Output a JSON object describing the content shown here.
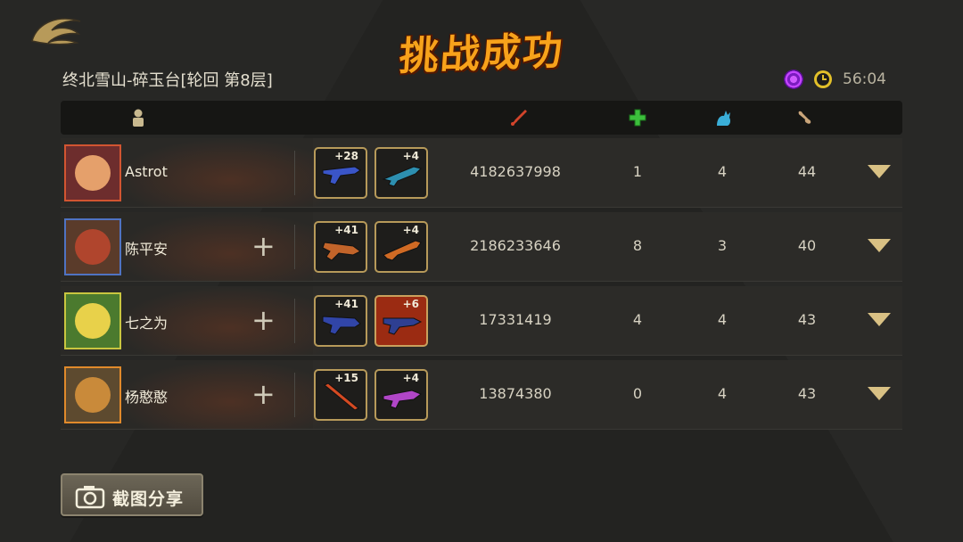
{
  "title": "挑战成功",
  "stage": "终北雪山-碎玉台[轮回 第8层]",
  "timer": "56:04",
  "headers": {
    "player_icon": "player-icon",
    "damage_icon": "sword-icon",
    "heal_icon": "green-cross-icon",
    "pet_icon": "blue-cat-icon",
    "bone_icon": "bone-icon"
  },
  "players": [
    {
      "name": "Astrot",
      "weapon1_level": "+28",
      "weapon2_level": "+4",
      "damage": "4182637998",
      "col1": "1",
      "col2": "4",
      "col3": "44",
      "has_plus": false
    },
    {
      "name": "陈平安",
      "weapon1_level": "+41",
      "weapon2_level": "+4",
      "damage": "2186233646",
      "col1": "8",
      "col2": "3",
      "col3": "40",
      "has_plus": true
    },
    {
      "name": "七之为",
      "weapon1_level": "+41",
      "weapon2_level": "+6",
      "damage": "17331419",
      "col1": "4",
      "col2": "4",
      "col3": "43",
      "has_plus": true
    },
    {
      "name": "杨憨憨",
      "weapon1_level": "+15",
      "weapon2_level": "+4",
      "damage": "13874380",
      "col1": "0",
      "col2": "4",
      "col3": "43",
      "has_plus": true
    }
  ],
  "share_button": "截图分享",
  "colors": {
    "title": "#f7a21b",
    "accent": "#d9c184"
  }
}
